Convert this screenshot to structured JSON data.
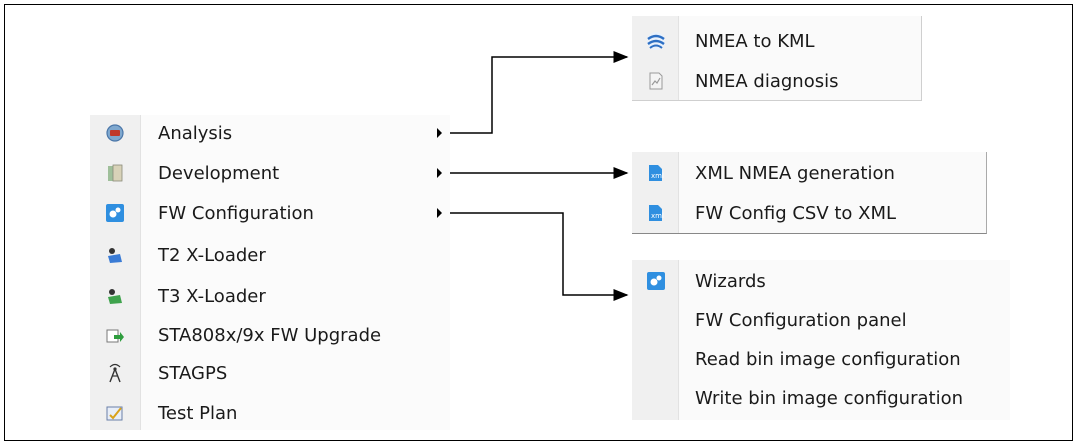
{
  "main_menu": {
    "items": [
      {
        "label": "Analysis",
        "icon": "analysis-icon",
        "has_submenu": true
      },
      {
        "label": "Development",
        "icon": "development-icon",
        "has_submenu": true
      },
      {
        "label": "FW Configuration",
        "icon": "fw-configuration-icon",
        "has_submenu": true
      },
      {
        "label": "T2 X-Loader",
        "icon": "t2-loader-icon",
        "has_submenu": false
      },
      {
        "label": "T3 X-Loader",
        "icon": "t3-loader-icon",
        "has_submenu": false
      },
      {
        "label": "STA808x/9x FW Upgrade",
        "icon": "fw-upgrade-icon",
        "has_submenu": false
      },
      {
        "label": "STAGPS",
        "icon": "antenna-icon",
        "has_submenu": false
      },
      {
        "label": "Test Plan",
        "icon": "test-plan-icon",
        "has_submenu": false
      }
    ]
  },
  "submenus": {
    "analysis": {
      "items": [
        {
          "label": "NMEA to KML",
          "icon": "kml-globe-icon"
        },
        {
          "label": "NMEA diagnosis",
          "icon": "diagnosis-document-icon"
        }
      ]
    },
    "development": {
      "items": [
        {
          "label": "XML NMEA generation",
          "icon": "xml-generator-icon"
        },
        {
          "label": "FW Config CSV to XML",
          "icon": "csv-to-xml-icon"
        }
      ]
    },
    "fw_configuration": {
      "items": [
        {
          "label": "Wizards",
          "icon": "wizard-icon"
        },
        {
          "label": "FW Configuration panel",
          "icon": ""
        },
        {
          "label": "Read bin image configuration",
          "icon": ""
        },
        {
          "label": "Write bin image configuration",
          "icon": ""
        }
      ]
    }
  }
}
